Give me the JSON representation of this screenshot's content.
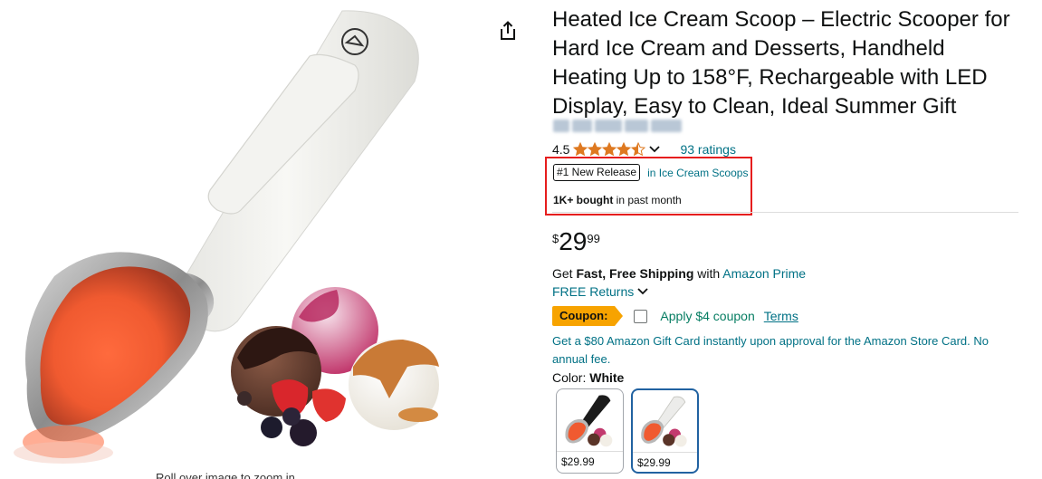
{
  "product": {
    "title": "Heated Ice Cream Scoop – Electric Scooper for Hard Ice Cream and Desserts, Handheld Heating Up to 158°F, Rechargeable with LED Display, Easy to Clean, Ideal Summer Gift",
    "brand_logo_text": "DALICODE",
    "rollover_hint": "Roll over image to zoom in"
  },
  "rating": {
    "value": "4.5",
    "stars": 4.5,
    "count_label": "93 ratings"
  },
  "badge": {
    "label": "#1 New Release",
    "category": "in Ice Cream Scoops"
  },
  "bought": {
    "bold": "1K+ bought",
    "rest": " in past month"
  },
  "price": {
    "symbol": "$",
    "whole": "29",
    "fraction": "99"
  },
  "shipping": {
    "get": "Get ",
    "bold": "Fast, Free Shipping",
    "with": " with ",
    "prime_link": "Amazon Prime",
    "returns": "FREE Returns"
  },
  "coupon": {
    "tag": "Coupon:",
    "text": "Apply $4 coupon",
    "terms": "Terms"
  },
  "gift_card": "Get a $80 Amazon Gift Card instantly upon approval for the Amazon Store Card. No annual fee.",
  "color": {
    "label": "Color: ",
    "selected": "White",
    "swatches": [
      {
        "name": "Black",
        "price": "$29.99"
      },
      {
        "name": "White",
        "price": "$29.99"
      }
    ]
  },
  "colors": {
    "link": "#007185",
    "star": "#DE7921",
    "coupon_tag": "#F7A300",
    "coupon_text": "#067D62",
    "highlight": "#e61e1e",
    "selected_swatch": "#2162A1"
  },
  "icons": {
    "share": "share-icon",
    "chevron": "chevron-down-icon"
  }
}
